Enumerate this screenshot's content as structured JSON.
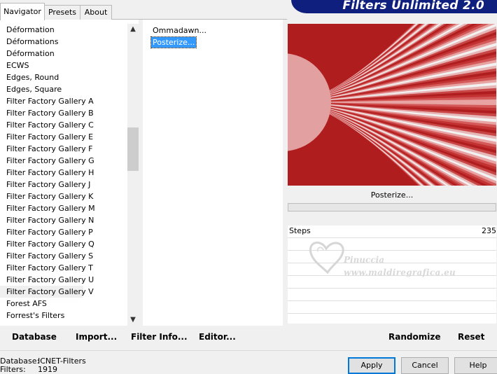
{
  "tabs": [
    "Navigator",
    "Presets",
    "About"
  ],
  "banner_title": "Filters Unlimited 2.0",
  "categories": [
    "Déformation",
    "Déformations",
    "Déformation",
    "ECWS",
    "Edges, Round",
    "Edges, Square",
    "Filter Factory Gallery A",
    "Filter Factory Gallery B",
    "Filter Factory Gallery C",
    "Filter Factory Gallery E",
    "Filter Factory Gallery F",
    "Filter Factory Gallery G",
    "Filter Factory Gallery H",
    "Filter Factory Gallery J",
    "Filter Factory Gallery K",
    "Filter Factory Gallery M",
    "Filter Factory Gallery N",
    "Filter Factory Gallery P",
    "Filter Factory Gallery Q",
    "Filter Factory Gallery S",
    "Filter Factory Gallery T",
    "Filter Factory Gallery U",
    "Filter Factory Gallery V",
    "Forest AFS",
    "Forrest's Filters"
  ],
  "selected_category": "Filter Factory Gallery V",
  "filters": [
    "Ommadawn...",
    "Posterize..."
  ],
  "selected_filter": "Posterize...",
  "preview_filter_name": "Posterize...",
  "params": [
    {
      "label": "Steps",
      "value": "235"
    }
  ],
  "watermark": {
    "name": "Pinuccia",
    "url": "www.maldiregrafica.eu"
  },
  "buttons": {
    "database": "Database",
    "import": "Import...",
    "filter_info": "Filter Info...",
    "editor": "Editor...",
    "randomize": "Randomize",
    "reset": "Reset",
    "apply": "Apply",
    "cancel": "Cancel",
    "help": "Help"
  },
  "status": {
    "database_label": "Database:",
    "database_value": "ICNET-Filters",
    "filters_label": "Filters:",
    "filters_value": "1919"
  },
  "colors": {
    "banner": "#0e1f7e",
    "selection": "#3399ff",
    "preview_dark": "#b01d1f",
    "preview_light": "#f2f2f2"
  }
}
